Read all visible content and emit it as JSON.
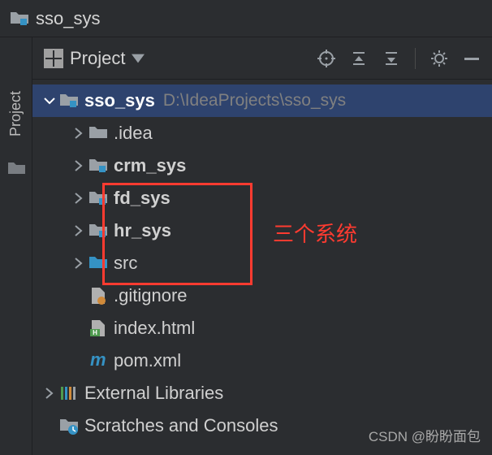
{
  "titlebar": {
    "title": "sso_sys"
  },
  "siderail": {
    "tab": "Project"
  },
  "toolbar": {
    "view_label": "Project"
  },
  "tree": {
    "root": {
      "name": "sso_sys",
      "path": "D:\\IdeaProjects\\sso_sys"
    },
    "children": {
      "idea": ".idea",
      "crm": "crm_sys",
      "fd": "fd_sys",
      "hr": "hr_sys",
      "src": "src",
      "gitignore": ".gitignore",
      "index": "index.html",
      "pom": "pom.xml"
    },
    "external": "External Libraries",
    "scratches": "Scratches and Consoles"
  },
  "annotation": "三个系统",
  "watermark": "CSDN @盼盼面包"
}
